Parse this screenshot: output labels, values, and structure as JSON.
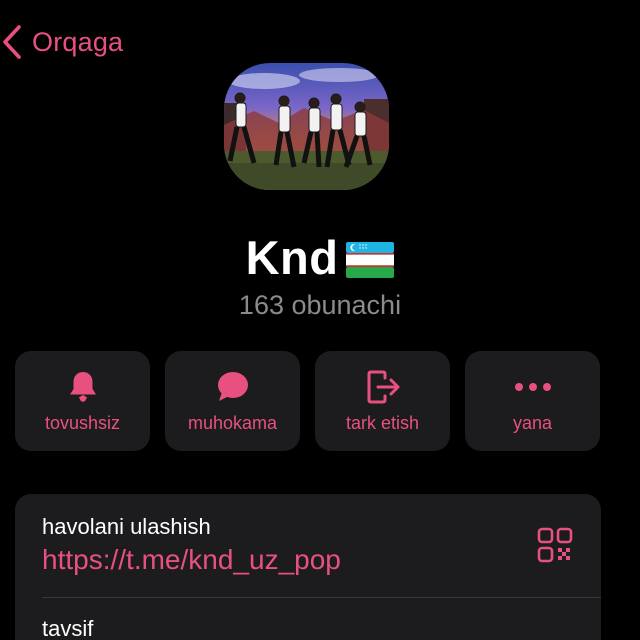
{
  "nav": {
    "back_label": "Orqaga",
    "back_icon": "chevron-left-icon"
  },
  "channel": {
    "name": "Knd",
    "flag": "uz-flag",
    "subscribers": "163 obunachi"
  },
  "actions": [
    {
      "label": "tovushsiz",
      "icon": "bell-icon"
    },
    {
      "label": "muhokama",
      "icon": "chat-bubble-icon"
    },
    {
      "label": "tark etish",
      "icon": "leave-icon"
    },
    {
      "label": "yana",
      "icon": "more-icon"
    }
  ],
  "info": {
    "link_label": "havolani ulashish",
    "link_value": "https://t.me/knd_uz_pop",
    "qr_icon": "qr-code-icon",
    "description_label": "tavsif"
  },
  "colors": {
    "background": "#000000",
    "accent": "#e8507f",
    "card": "#1c1c1e",
    "muted": "#8b8b8f",
    "text": "#ffffff"
  }
}
